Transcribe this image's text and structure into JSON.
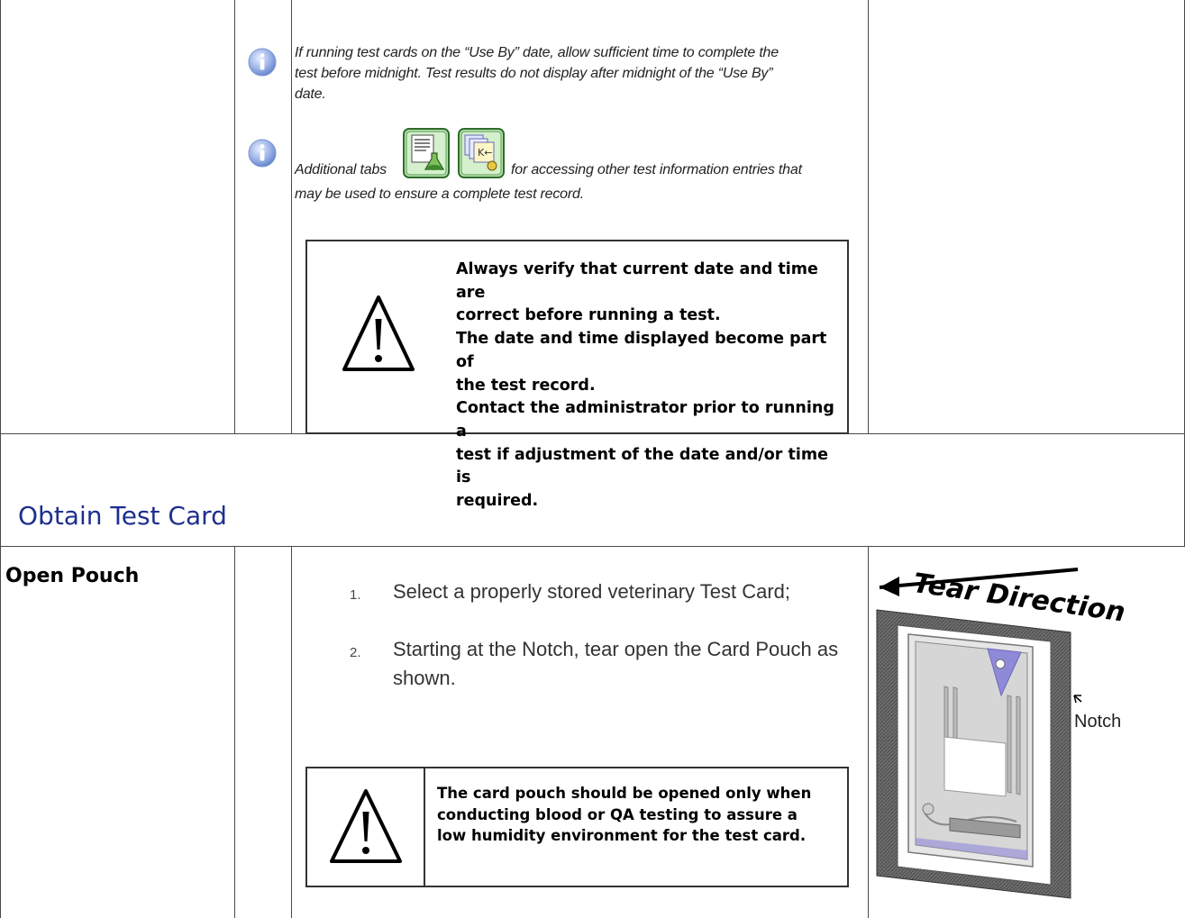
{
  "notes": [
    {
      "text_lines": [
        "If running test cards on the “Use By” date, allow sufficient time to complete the",
        "test before midnight. Test results do not display after midnight of the “Use By”",
        "date."
      ]
    },
    {
      "text_before": "Additional tabs",
      "text_after": " for accessing other test information entries that",
      "text_line2": "may be used to ensure a complete test record."
    }
  ],
  "warning_1": {
    "lines": [
      "Always verify that current date and time are",
      "correct before running a test.",
      "The date and time displayed become part of",
      "the test record.",
      "Contact the administrator prior to running a",
      "test if adjustment of the date and/or time is",
      "required."
    ]
  },
  "section": {
    "title": "Obtain Test Card"
  },
  "open_pouch": {
    "label": "Open Pouch",
    "steps": [
      {
        "num": "1.",
        "lines": [
          "Select a properly stored veterinary Test Card;"
        ]
      },
      {
        "num": "2.",
        "lines": [
          "Starting at the Notch, tear open the Card Pouch as",
          "shown."
        ]
      }
    ]
  },
  "warning_2": {
    "lines": [
      "The card pouch should be opened only when",
      "conducting blood or QA testing to  assure a",
      "low humidity environment for the test card."
    ]
  },
  "figure": {
    "tear_label": "Tear Direction",
    "notch_label": "Notch"
  },
  "icons": {
    "info": "info-icon",
    "warning": "warning-triangle-icon",
    "tab_results": "results-tab-icon",
    "tab_keyboard": "keyboard-tab-icon"
  }
}
